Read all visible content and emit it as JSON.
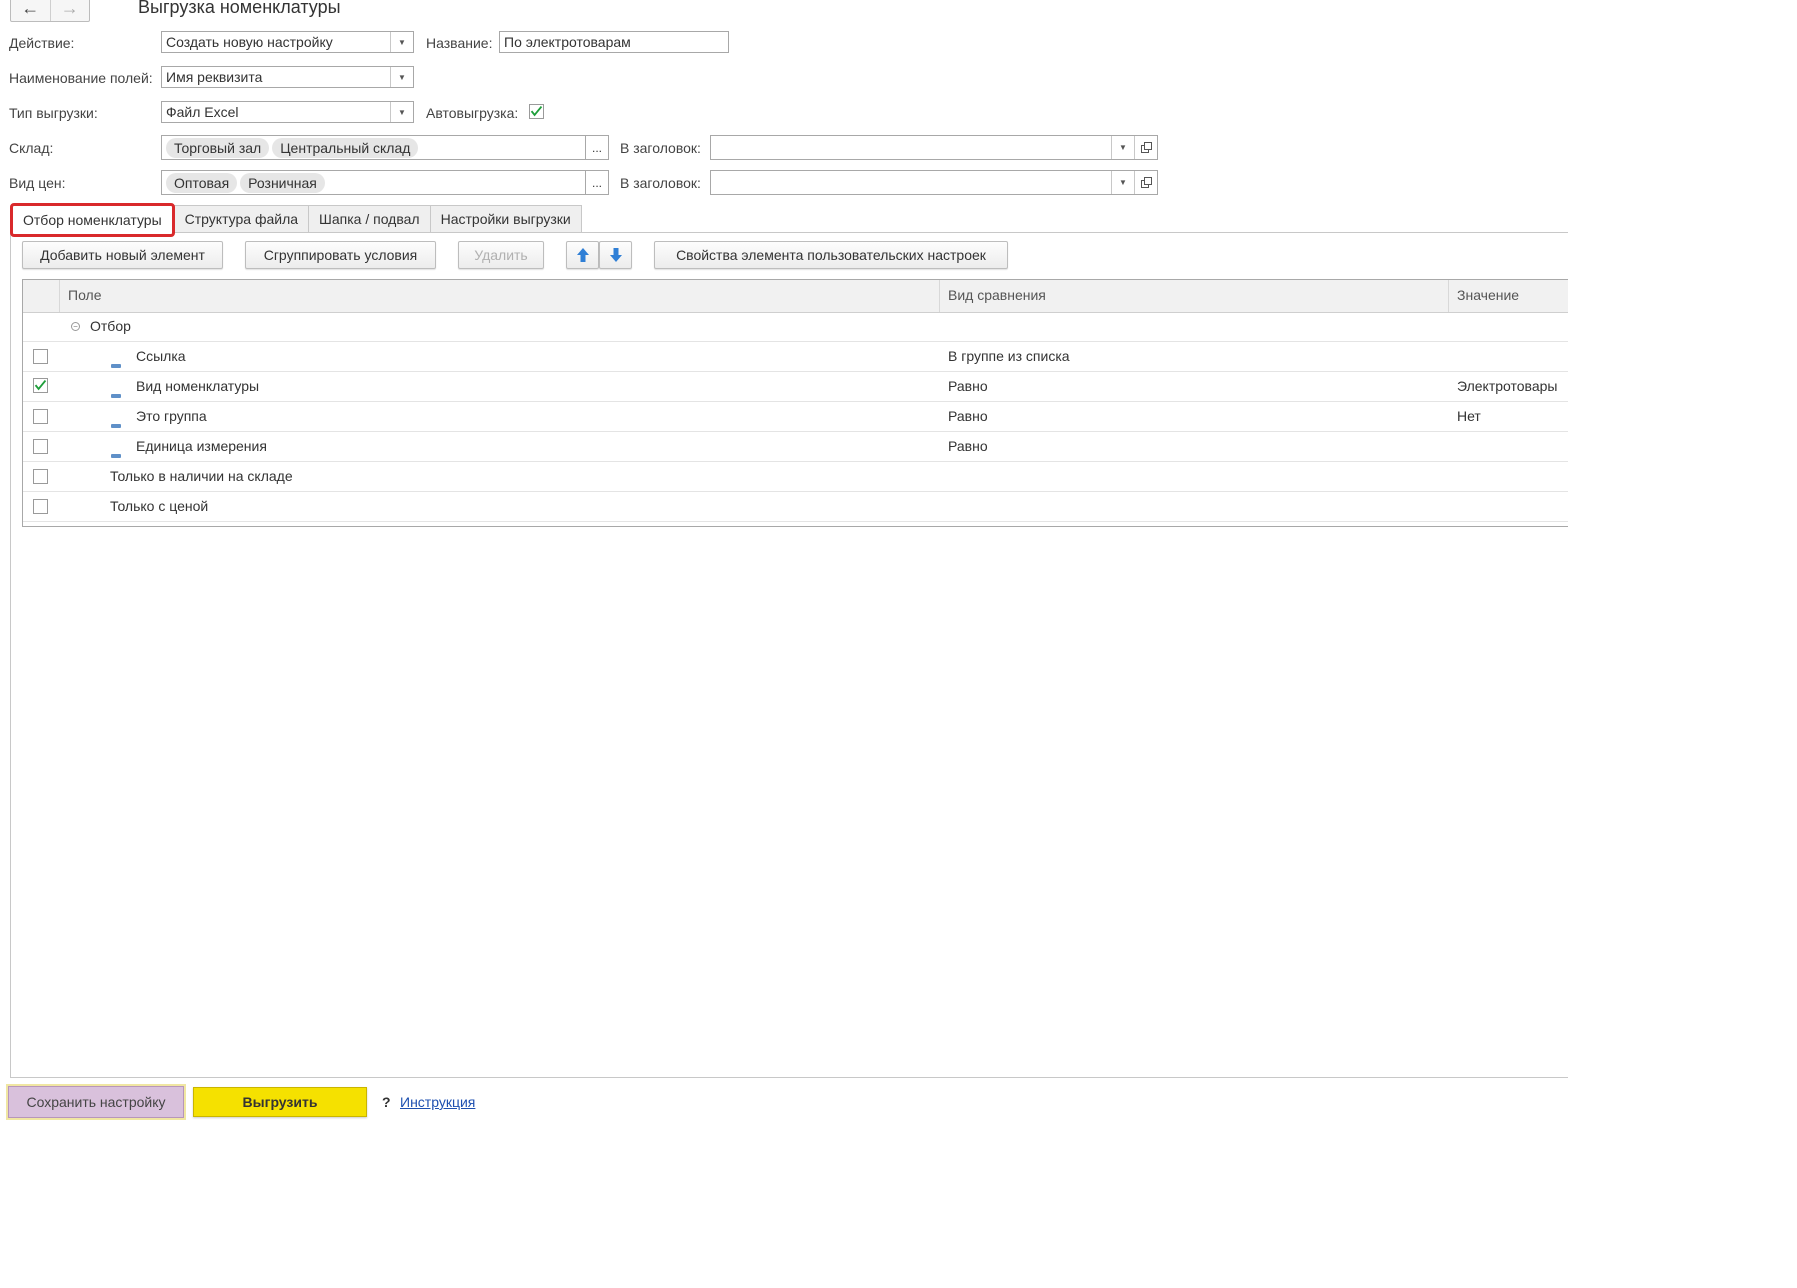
{
  "window": {
    "title": "Выгрузка номенклатуры"
  },
  "form": {
    "action": {
      "label": "Действие:",
      "value": "Создать новую настройку"
    },
    "name": {
      "label": "Название:",
      "value": "По электротоварам"
    },
    "field_naming": {
      "label": "Наименование полей:",
      "value": "Имя реквизита"
    },
    "export_type": {
      "label": "Тип выгрузки:",
      "value": "Файл Excel"
    },
    "auto_export": {
      "label": "Автовыгрузка:",
      "checked": true
    },
    "warehouse": {
      "label": "Склад:",
      "tags": [
        "Торговый зал",
        "Центральный склад"
      ],
      "header_label": "В заголовок:",
      "header_value": "",
      "ellipsis": "..."
    },
    "price_type": {
      "label": "Вид цен:",
      "tags": [
        "Оптовая",
        "Розничная"
      ],
      "header_label": "В заголовок:",
      "header_value": "",
      "ellipsis": "..."
    }
  },
  "tabs": [
    "Отбор номенклатуры",
    "Структура файла",
    "Шапка / подвал",
    "Настройки выгрузки"
  ],
  "active_tab": 0,
  "toolbar": {
    "add_label": "Добавить новый элемент",
    "group_label": "Сгруппировать условия",
    "delete_label": "Удалить",
    "properties_label": "Свойства элемента пользовательских настроек"
  },
  "grid": {
    "columns": [
      "Поле",
      "Вид сравнения",
      "Значение"
    ],
    "group_row": "Отбор",
    "rows": [
      {
        "field": "Ссылка",
        "comparison": "В группе из списка",
        "value": "",
        "checked": false,
        "nested": true
      },
      {
        "field": "Вид номенклатуры",
        "comparison": "Равно",
        "value": "Электротовары",
        "checked": true,
        "nested": true
      },
      {
        "field": "Это группа",
        "comparison": "Равно",
        "value": "Нет",
        "checked": false,
        "nested": true
      },
      {
        "field": "Единица измерения",
        "comparison": "Равно",
        "value": "",
        "checked": false,
        "nested": true
      },
      {
        "field": "Только в наличии на складе",
        "comparison": "",
        "value": "",
        "checked": false,
        "nested": false
      },
      {
        "field": "Только с ценой",
        "comparison": "",
        "value": "",
        "checked": false,
        "nested": false
      }
    ]
  },
  "footer": {
    "save_label": "Сохранить настройку",
    "export_label": "Выгрузить",
    "help_mark": "?",
    "help_link": "Инструкция"
  },
  "colors": {
    "accent_green": "#1e9e3a",
    "export_yellow": "#f5e100",
    "save_purple": "#d9c1dc",
    "active_tab_border": "#d9292b",
    "link_blue": "#1d4fb0"
  }
}
